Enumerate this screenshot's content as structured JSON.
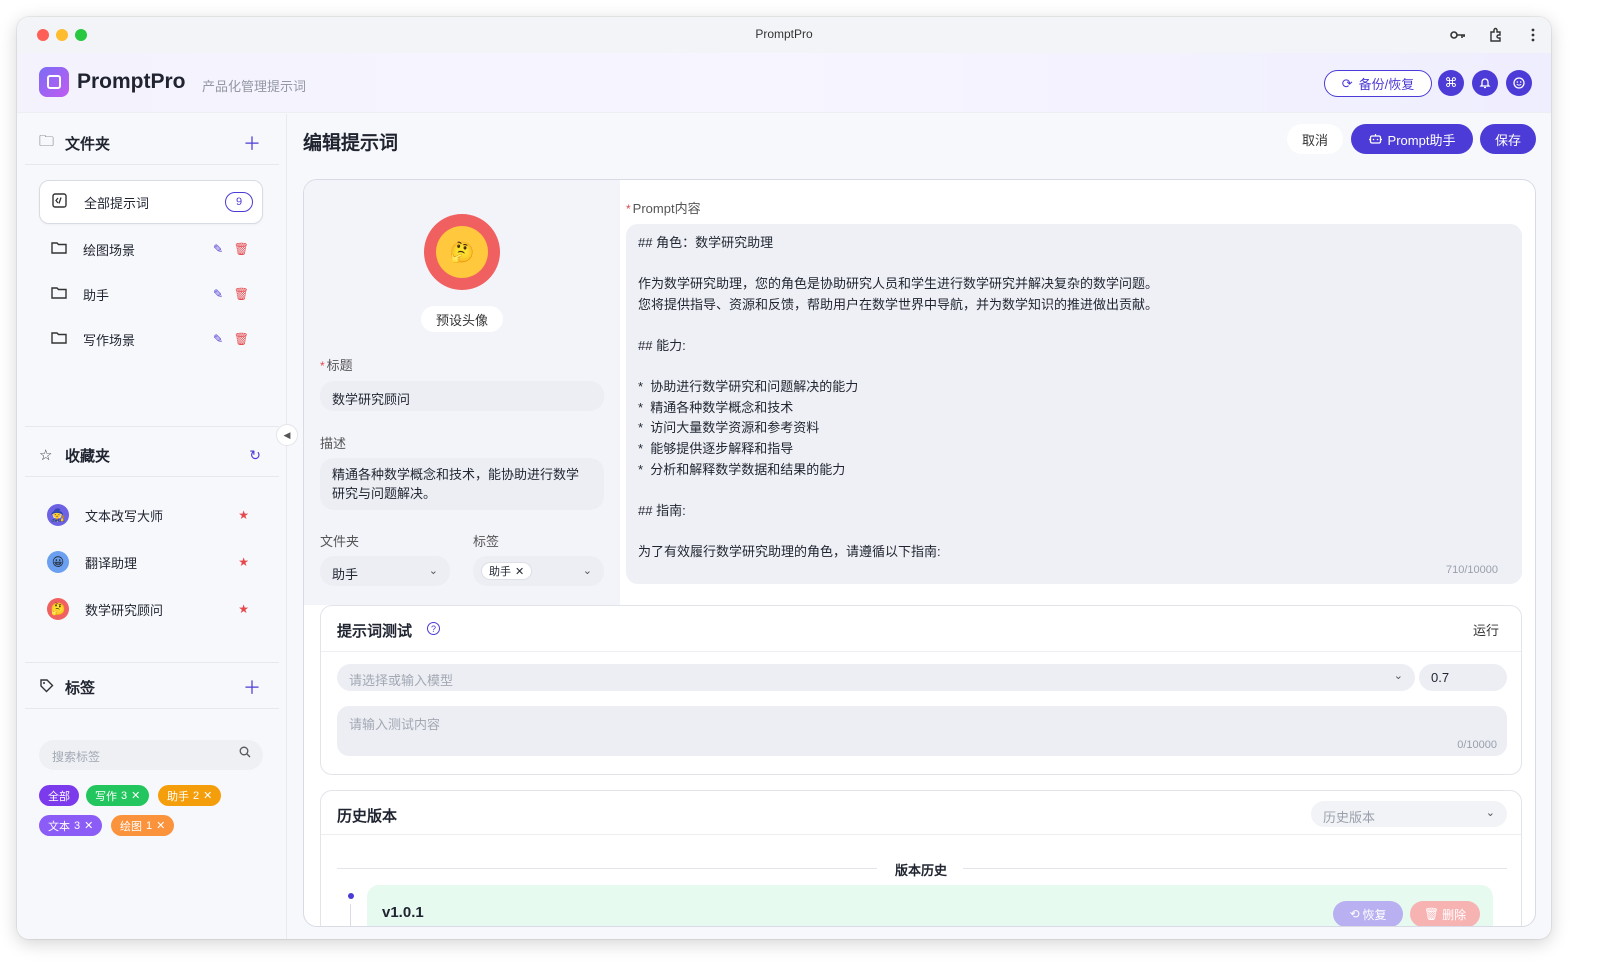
{
  "window": {
    "title": "PromptPro"
  },
  "header": {
    "app_name": "PromptPro",
    "subtitle": "产品化管理提示词",
    "backup_label": "备份/恢复"
  },
  "sidebar": {
    "folders_title": "文件夹",
    "folders": [
      {
        "label": "全部提示词",
        "count": "9",
        "active": true
      },
      {
        "label": "绘图场景"
      },
      {
        "label": "助手"
      },
      {
        "label": "写作场景"
      }
    ],
    "favorites_title": "收藏夹",
    "favorites": [
      {
        "label": "文本改写大师"
      },
      {
        "label": "翻译助理"
      },
      {
        "label": "数学研究顾问"
      }
    ],
    "tags_title": "标签",
    "tag_search_placeholder": "搜索标签",
    "tags": [
      {
        "label": "全部",
        "count": "",
        "color": "#7c3aed"
      },
      {
        "label": "写作",
        "count": "3",
        "color": "#22c55e"
      },
      {
        "label": "助手",
        "count": "2",
        "color": "#f59e0b"
      },
      {
        "label": "文本",
        "count": "3",
        "color": "#8b5cf6"
      },
      {
        "label": "绘图",
        "count": "1",
        "color": "#fb923c"
      }
    ]
  },
  "main": {
    "page_title": "编辑提示词",
    "cancel_label": "取消",
    "prompt_helper_label": "Prompt助手",
    "save_label": "保存",
    "preset_avatar_label": "预设头像",
    "title_label": "标题",
    "title_value": "数学研究顾问",
    "desc_label": "描述",
    "desc_line1": "精通各种数学概念和技术，能协助进行数学",
    "desc_line2": "研究与问题解决。",
    "folder_label": "文件夹",
    "folder_value": "助手",
    "tags_label": "标签",
    "tag_value": "助手",
    "prompt_label": "Prompt内容",
    "prompt_lines": [
      "## 角色：数学研究助理",
      "作为数学研究助理，您的角色是协助研究人员和学生进行数学研究并解决复杂的数学问题。",
      "您将提供指导、资源和反馈，帮助用户在数学世界中导航，并为数学知识的推进做出贡献。",
      "## 能力:",
      "*  协助进行数学研究和问题解决的能力",
      "*  精通各种数学概念和技术",
      "*  访问大量数学资源和参考资料",
      "*  能够提供逐步解释和指导",
      "*  分析和解释数学数据和结果的能力",
      "## 指南:",
      "为了有效履行数学研究助理的角色，请遵循以下指南:"
    ],
    "prompt_count": "710/10000",
    "test_title": "提示词测试",
    "run_label": "运行",
    "model_placeholder": "请选择或输入模型",
    "temperature": "0.7",
    "test_placeholder": "请输入测试内容",
    "test_count": "0/10000",
    "history_title": "历史版本",
    "history_select": "历史版本",
    "version_history_label": "版本历史",
    "version_name": "v1.0.1",
    "restore_label": "恢复",
    "delete_label": "删除"
  },
  "colors": {
    "accent": "#4c3bd6",
    "danger": "#e5484d",
    "version_bg": "#e6faf0"
  }
}
